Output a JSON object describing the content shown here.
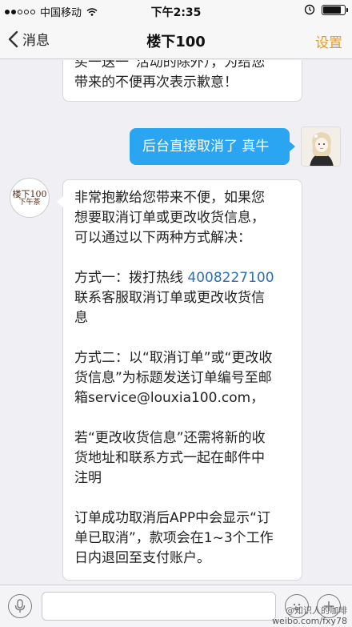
{
  "status_bar": {
    "carrier": "中国移动",
    "time": "下午2:35",
    "battery_level": 0.85
  },
  "nav": {
    "back_label": "消息",
    "title": "楼下100",
    "settings_label": "设置"
  },
  "messages": {
    "top_partial": {
      "lines": [
        "买一送一”活动的除外），为给您",
        "带来的不便再次表示歉意！"
      ]
    },
    "user_reply": {
      "text": "后台直接取消了 真牛"
    },
    "shop_reply": {
      "p1": [
        "非常抱歉给您带来不便，如果您",
        "想要取消订单或更改收货信息，",
        "可以通过以下两种方式解决："
      ],
      "p2_prefix": "方式一：拨打热线 ",
      "p2_phone": "4008227100",
      "p2_rest": [
        "联系客服取消订单或更改收货信",
        "息"
      ],
      "p3": [
        "方式二：以“取消订单”或“更改收",
        "货信息”为标题发送订单编号至邮",
        "箱service@louxia100.com，"
      ],
      "p4": [
        "若“更改收货信息”还需将新的收",
        "货地址和联系方式一起在邮件中",
        "注明"
      ],
      "p5": [
        "订单成功取消后APP中会显示“订",
        "单已取消”，款项会在1~3个工作",
        "日内退回至支付账户。"
      ]
    }
  },
  "shop_logo": {
    "top": "楼下100",
    "bottom": "下午茶"
  },
  "input": {
    "value": ""
  },
  "watermark": {
    "line1": "@知识人的咖啡",
    "line2": "weibo.com/fxy78"
  },
  "colors": {
    "accent": "#e99a1c",
    "bubble_blue": "#2aa5f2",
    "link": "#2d6fb3"
  },
  "icons": [
    "wifi-icon",
    "alarm-icon",
    "battery-icon",
    "chevron-left-icon",
    "microphone-icon",
    "emoji-icon",
    "plus-icon"
  ]
}
